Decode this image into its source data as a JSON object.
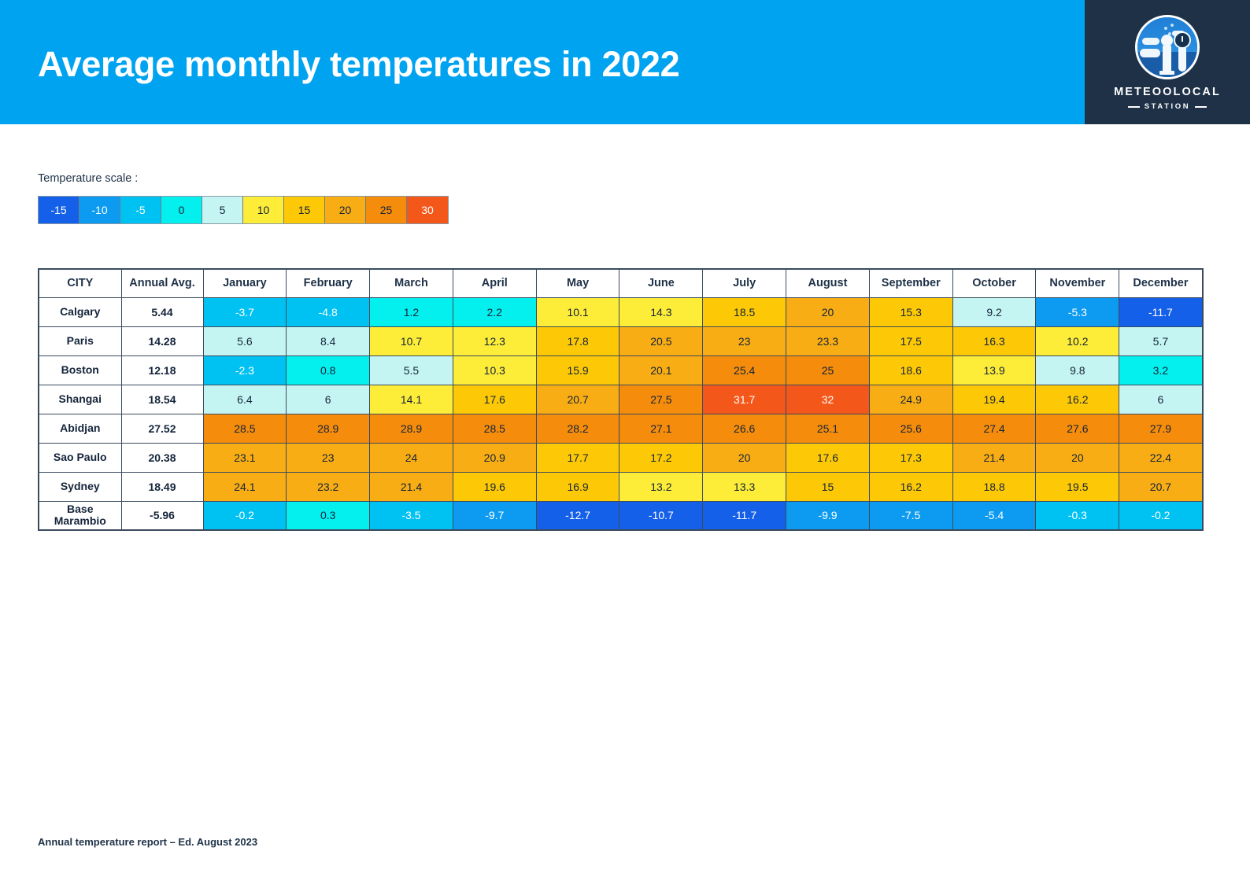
{
  "header": {
    "title": "Average monthly temperatures in 2022",
    "bar_color": "#00a3ef",
    "logo_panel_color": "#1e3147",
    "logo_name": "METEOOLOCAL",
    "logo_subtitle": "STATION"
  },
  "legend": {
    "label": "Temperature scale :",
    "stops": [
      {
        "value": "-15",
        "color": "#1560e8",
        "text_color": "#ffffff"
      },
      {
        "value": "-10",
        "color": "#0c9bf0",
        "text_color": "#ffffff"
      },
      {
        "value": "-5",
        "color": "#00c2f2",
        "text_color": "#ffffff"
      },
      {
        "value": "0",
        "color": "#04f0ef",
        "text_color": "#14243a"
      },
      {
        "value": "5",
        "color": "#c5f5f3",
        "text_color": "#14243a"
      },
      {
        "value": "10",
        "color": "#fdec38",
        "text_color": "#14243a"
      },
      {
        "value": "15",
        "color": "#fdc907",
        "text_color": "#14243a"
      },
      {
        "value": "20",
        "color": "#f9ad14",
        "text_color": "#14243a"
      },
      {
        "value": "25",
        "color": "#f58c0c",
        "text_color": "#14243a"
      },
      {
        "value": "30",
        "color": "#f4571a",
        "text_color": "#ffffff"
      }
    ]
  },
  "table": {
    "columns": [
      "CITY",
      "Annual Avg.",
      "January",
      "February",
      "March",
      "April",
      "May",
      "June",
      "July",
      "August",
      "September",
      "October",
      "November",
      "December"
    ],
    "rows": [
      {
        "city": "Calgary",
        "annual_avg": "5.44",
        "months": [
          "-3.7",
          "-4.8",
          "1.2",
          "2.2",
          "10.1",
          "14.3",
          "18.5",
          "20",
          "15.3",
          "9.2",
          "-5.3",
          "-11.7"
        ]
      },
      {
        "city": "Paris",
        "annual_avg": "14.28",
        "months": [
          "5.6",
          "8.4",
          "10.7",
          "12.3",
          "17.8",
          "20.5",
          "23",
          "23.3",
          "17.5",
          "16.3",
          "10.2",
          "5.7"
        ]
      },
      {
        "city": "Boston",
        "annual_avg": "12.18",
        "months": [
          "-2.3",
          "0.8",
          "5.5",
          "10.3",
          "15.9",
          "20.1",
          "25.4",
          "25",
          "18.6",
          "13.9",
          "9.8",
          "3.2"
        ]
      },
      {
        "city": "Shangai",
        "annual_avg": "18.54",
        "months": [
          "6.4",
          "6",
          "14.1",
          "17.6",
          "20.7",
          "27.5",
          "31.7",
          "32",
          "24.9",
          "19.4",
          "16.2",
          "6"
        ]
      },
      {
        "city": "Abidjan",
        "annual_avg": "27.52",
        "months": [
          "28.5",
          "28.9",
          "28.9",
          "28.5",
          "28.2",
          "27.1",
          "26.6",
          "25.1",
          "25.6",
          "27.4",
          "27.6",
          "27.9"
        ]
      },
      {
        "city": "Sao Paulo",
        "annual_avg": "20.38",
        "months": [
          "23.1",
          "23",
          "24",
          "20.9",
          "17.7",
          "17.2",
          "20",
          "17.6",
          "17.3",
          "21.4",
          "20",
          "22.4"
        ]
      },
      {
        "city": "Sydney",
        "annual_avg": "18.49",
        "months": [
          "24.1",
          "23.2",
          "21.4",
          "19.6",
          "16.9",
          "13.2",
          "13.3",
          "15",
          "16.2",
          "18.8",
          "19.5",
          "20.7"
        ]
      },
      {
        "city": "Base Marambio",
        "annual_avg": "-5.96",
        "months": [
          "-0.2",
          "0.3",
          "-3.5",
          "-9.7",
          "-12.7",
          "-10.7",
          "-11.7",
          "-9.9",
          "-7.5",
          "-5.4",
          "-0.3",
          "-0.2"
        ]
      }
    ]
  },
  "chart_data": {
    "type": "heatmap",
    "title": "Average monthly temperatures in 2022",
    "xlabel": "",
    "ylabel": "",
    "categories": [
      "January",
      "February",
      "March",
      "April",
      "May",
      "June",
      "July",
      "August",
      "September",
      "October",
      "November",
      "December"
    ],
    "series": [
      {
        "name": "Calgary",
        "annual_avg": 5.44,
        "values": [
          -3.7,
          -4.8,
          1.2,
          2.2,
          10.1,
          14.3,
          18.5,
          20,
          15.3,
          9.2,
          -5.3,
          -11.7
        ]
      },
      {
        "name": "Paris",
        "annual_avg": 14.28,
        "values": [
          5.6,
          8.4,
          10.7,
          12.3,
          17.8,
          20.5,
          23,
          23.3,
          17.5,
          16.3,
          10.2,
          5.7
        ]
      },
      {
        "name": "Boston",
        "annual_avg": 12.18,
        "values": [
          -2.3,
          0.8,
          5.5,
          10.3,
          15.9,
          20.1,
          25.4,
          25,
          18.6,
          13.9,
          9.8,
          3.2
        ]
      },
      {
        "name": "Shangai",
        "annual_avg": 18.54,
        "values": [
          6.4,
          6,
          14.1,
          17.6,
          20.7,
          27.5,
          31.7,
          32,
          24.9,
          19.4,
          16.2,
          6
        ]
      },
      {
        "name": "Abidjan",
        "annual_avg": 27.52,
        "values": [
          28.5,
          28.9,
          28.9,
          28.5,
          28.2,
          27.1,
          26.6,
          25.1,
          25.6,
          27.4,
          27.6,
          27.9
        ]
      },
      {
        "name": "Sao Paulo",
        "annual_avg": 20.38,
        "values": [
          23.1,
          23,
          24,
          20.9,
          17.7,
          17.2,
          20,
          17.6,
          17.3,
          21.4,
          20,
          22.4
        ]
      },
      {
        "name": "Sydney",
        "annual_avg": 18.49,
        "values": [
          24.1,
          23.2,
          21.4,
          19.6,
          16.9,
          13.2,
          13.3,
          15,
          16.2,
          18.8,
          19.5,
          20.7
        ]
      },
      {
        "name": "Base Marambio",
        "annual_avg": -5.96,
        "values": [
          -0.2,
          0.3,
          -3.5,
          -9.7,
          -12.7,
          -10.7,
          -11.7,
          -9.9,
          -7.5,
          -5.4,
          -0.3,
          -0.2
        ]
      }
    ],
    "colorscale": [
      {
        "stop": -15,
        "color": "#1560e8"
      },
      {
        "stop": -10,
        "color": "#0c9bf0"
      },
      {
        "stop": -5,
        "color": "#00c2f2"
      },
      {
        "stop": 0,
        "color": "#04f0ef"
      },
      {
        "stop": 5,
        "color": "#c5f5f3"
      },
      {
        "stop": 10,
        "color": "#fdec38"
      },
      {
        "stop": 15,
        "color": "#fdc907"
      },
      {
        "stop": 20,
        "color": "#f9ad14"
      },
      {
        "stop": 25,
        "color": "#f58c0c"
      },
      {
        "stop": 30,
        "color": "#f4571a"
      }
    ],
    "grid": true,
    "legend_position": "top-left"
  },
  "footer": {
    "text": "Annual temperature report – Ed. August 2023"
  }
}
